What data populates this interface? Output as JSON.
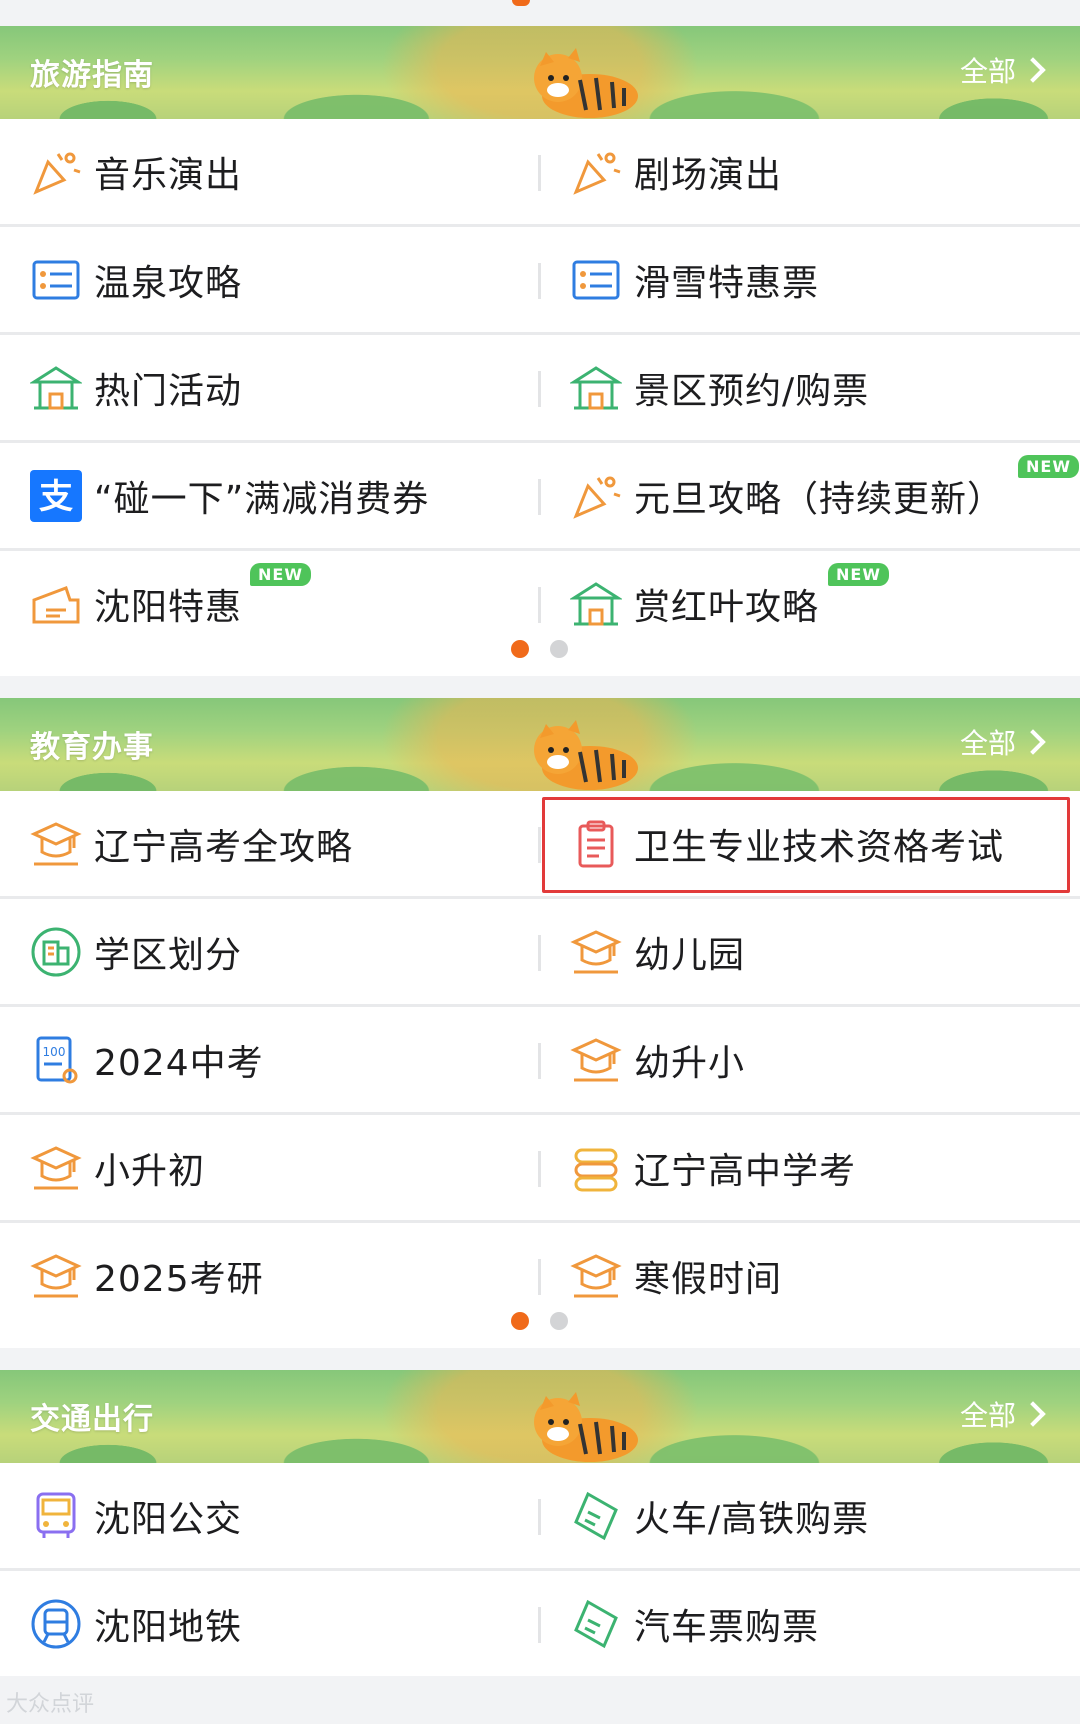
{
  "sections": [
    {
      "title": "旅游指南",
      "more_label": "全部",
      "rows": [
        {
          "left": {
            "label": "音乐演出",
            "icon": "party-popper-icon"
          },
          "right": {
            "label": "剧场演出",
            "icon": "party-popper-icon"
          }
        },
        {
          "left": {
            "label": "温泉攻略",
            "icon": "list-card-icon"
          },
          "right": {
            "label": "滑雪特惠票",
            "icon": "list-card-icon"
          }
        },
        {
          "left": {
            "label": "热门活动",
            "icon": "pavilion-icon"
          },
          "right": {
            "label": "景区预约/购票",
            "icon": "pavilion-icon"
          }
        },
        {
          "left": {
            "label": "“碰一下”满减消费券",
            "icon": "alipay-icon"
          },
          "right": {
            "label": "元旦攻略（持续更新）",
            "icon": "party-popper-icon",
            "badge": "NEW"
          }
        },
        {
          "left": {
            "label": "沈阳特惠",
            "icon": "ticket-icon",
            "badge": "NEW"
          },
          "right": {
            "label": "赏红叶攻略",
            "icon": "pavilion-icon",
            "badge": "NEW"
          }
        }
      ]
    },
    {
      "title": "教育办事",
      "more_label": "全部",
      "rows": [
        {
          "left": {
            "label": "辽宁高考全攻略",
            "icon": "graduation-cap-icon"
          },
          "right": {
            "label": "卫生专业技术资格考试",
            "icon": "clipboard-icon"
          }
        },
        {
          "left": {
            "label": "学区划分",
            "icon": "school-building-icon"
          },
          "right": {
            "label": "幼儿园",
            "icon": "graduation-cap-icon"
          }
        },
        {
          "left": {
            "label": "2024中考",
            "icon": "exam-score-icon"
          },
          "right": {
            "label": "幼升小",
            "icon": "graduation-cap-icon"
          }
        },
        {
          "left": {
            "label": "小升初",
            "icon": "graduation-cap-icon"
          },
          "right": {
            "label": "辽宁高中学考",
            "icon": "books-icon"
          }
        },
        {
          "left": {
            "label": "2025考研",
            "icon": "graduation-cap-icon"
          },
          "right": {
            "label": "寒假时间",
            "icon": "graduation-cap-icon"
          }
        }
      ]
    },
    {
      "title": "交通出行",
      "more_label": "全部",
      "rows": [
        {
          "left": {
            "label": "沈阳公交",
            "icon": "bus-icon"
          },
          "right": {
            "label": "火车/高铁购票",
            "icon": "train-ticket-icon"
          }
        },
        {
          "left": {
            "label": "沈阳地铁",
            "icon": "metro-icon"
          },
          "right": {
            "label": "汽车票购票",
            "icon": "train-ticket-icon"
          }
        }
      ]
    }
  ],
  "watermark": "大众点评",
  "colors": {
    "accent": "#f06a1a",
    "icon_orange": "#f0983c",
    "icon_blue": "#2f7de1",
    "icon_green": "#3cb371",
    "highlight": "#e23a3a",
    "badge": "#4fc45a"
  }
}
